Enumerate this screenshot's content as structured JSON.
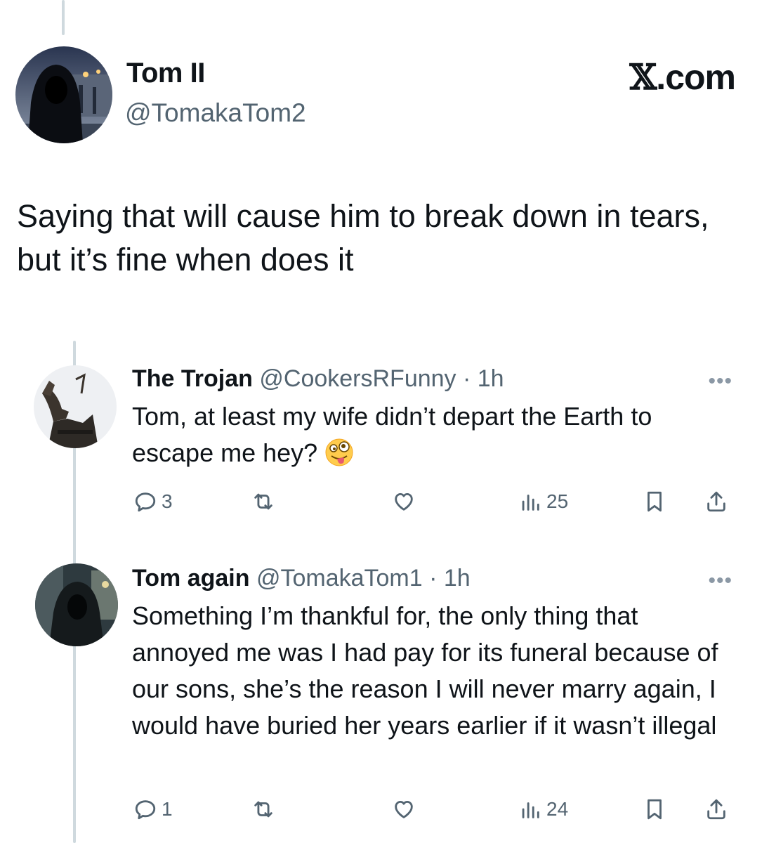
{
  "post": {
    "author_name": "Tom II",
    "author_handle": "@TomakaTom2",
    "brand": "X.com",
    "text": "Saying that will cause him to break down in tears, but it’s fine when does it"
  },
  "replies": [
    {
      "name": "The Trojan",
      "handle": "@CookersRFunny",
      "time": "· 1h",
      "text": "Tom, at least my wife didn’t depart the Earth to escape me hey?",
      "emoji": "zany-face",
      "reply_count": "3",
      "views": "25"
    },
    {
      "name": "Tom again",
      "handle": "@TomakaTom1",
      "time": "· 1h",
      "text": "Something I’m thankful for, the only thing that annoyed me was I had pay for its funeral because of our sons, she’s the reason I will never marry again, I would have buried her years earlier if it wasn’t illegal",
      "reply_count": "1",
      "views": "24"
    }
  ],
  "colors": {
    "text": "#0f1419",
    "secondary": "#536471",
    "thread": "#cfd9de"
  }
}
